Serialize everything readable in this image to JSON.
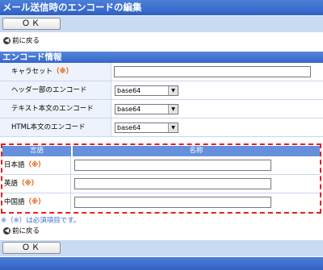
{
  "header": {
    "title": "メール送信時のエンコードの編集"
  },
  "ok_button": "ＯＫ",
  "back_link": "前に戻る",
  "section_title": "エンコード情報",
  "required_mark": "（※）",
  "form": {
    "charset_label": "キャラセット",
    "header_label": "ヘッダー部のエンコード",
    "header_value": "base64",
    "text_label": "テキスト本文のエンコード",
    "text_value": "base64",
    "html_label": "HTML本文のエンコード",
    "html_value": "base64"
  },
  "names_table": {
    "col_language": "言語",
    "col_name": "名称",
    "rows": [
      {
        "language": "日本語"
      },
      {
        "language": "英語"
      },
      {
        "language": "中国語"
      }
    ]
  },
  "note": "※（※）は必須項目です。"
}
